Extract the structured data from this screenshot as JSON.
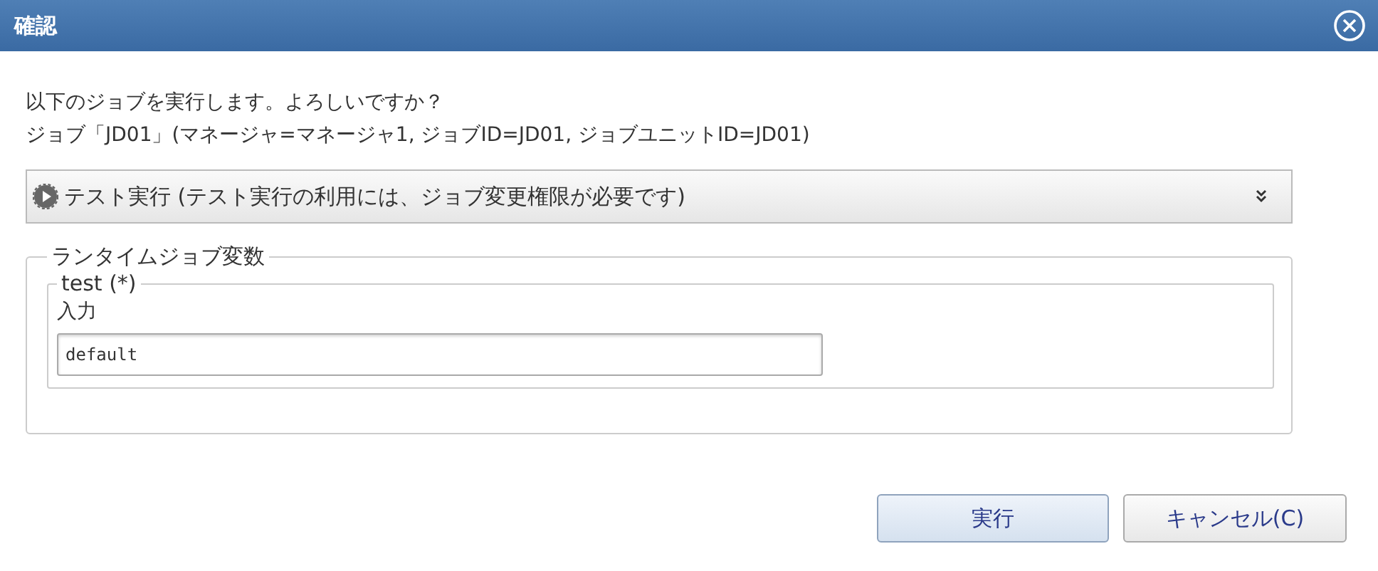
{
  "window": {
    "title": "確認"
  },
  "message": [
    "以下のジョブを実行します。よろしいですか？",
    "ジョブ「JD01」(マネージャ=マネージャ1, ジョブID=JD01, ジョブユニットID=JD01)"
  ],
  "test_run_panel": {
    "label": "テスト実行 (テスト実行の利用には、ジョブ変更権限が必要です)",
    "expanded": false
  },
  "runtime_variables": {
    "legend": "ランタイムジョブ変数",
    "variables": [
      {
        "legend": "test (*)",
        "label": "入力",
        "value": "default"
      }
    ]
  },
  "buttons": [
    {
      "label": "実行",
      "default": true
    },
    {
      "label": "キャンセル(C)",
      "default": false
    }
  ]
}
